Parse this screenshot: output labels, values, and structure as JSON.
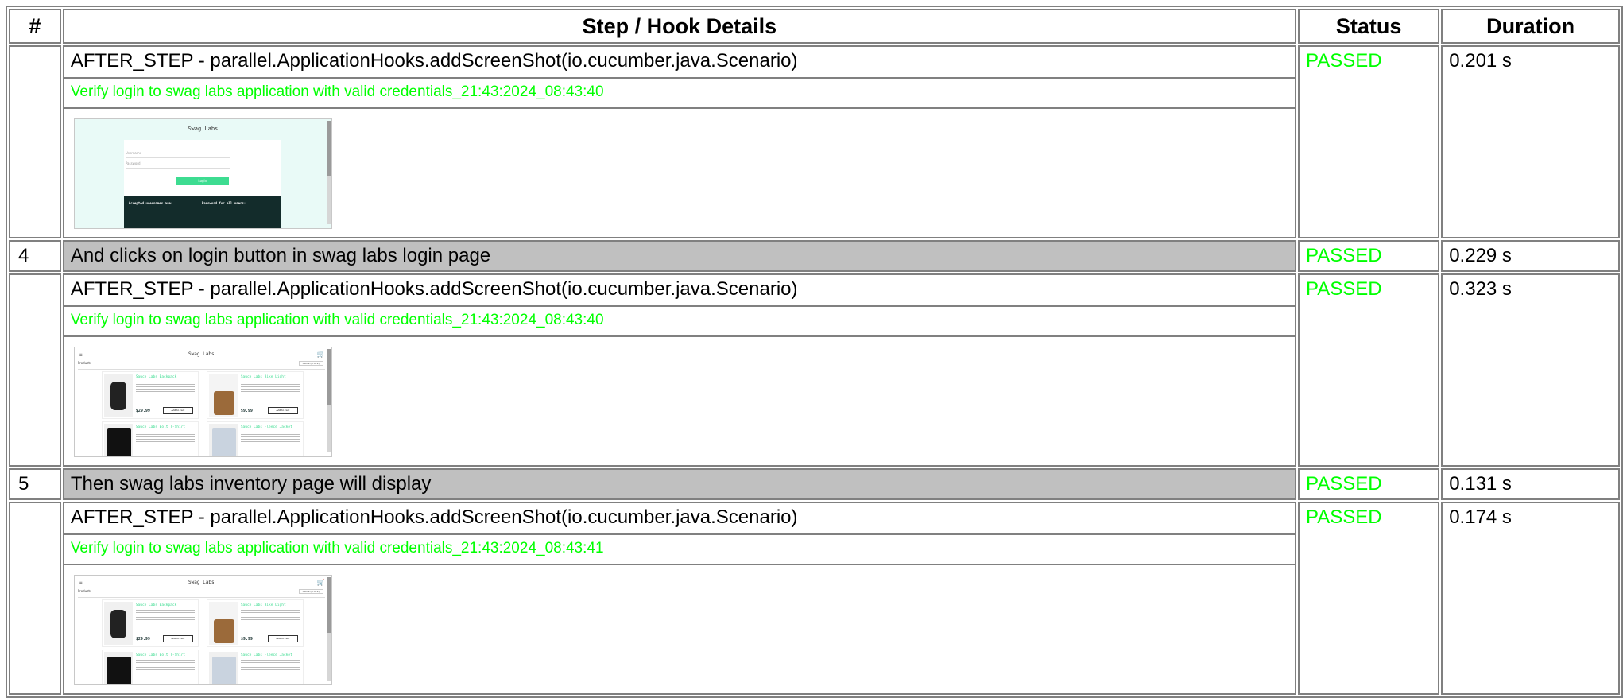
{
  "header": {
    "num": "#",
    "step": "Step / Hook Details",
    "status": "Status",
    "duration": "Duration"
  },
  "hooks": [
    {
      "title": "AFTER_STEP - parallel.ApplicationHooks.addScreenShot(io.cucumber.java.Scenario)",
      "name": "Verify login to swag labs application with valid credentials_21:43:2024_08:43:40",
      "status": "PASSED",
      "duration": "0.201 s",
      "screenshot": {
        "type": "login",
        "title": "Swag Labs",
        "username_placeholder": "Username",
        "password_placeholder": "Password",
        "button": "Login",
        "accepted_heading": "Accepted usernames are:",
        "password_heading": "Password for all users:"
      }
    },
    {
      "title": "AFTER_STEP - parallel.ApplicationHooks.addScreenShot(io.cucumber.java.Scenario)",
      "name": "Verify login to swag labs application with valid credentials_21:43:2024_08:43:40",
      "status": "PASSED",
      "duration": "0.323 s",
      "screenshot": {
        "type": "inventory",
        "title": "Swag Labs",
        "menu": "≡",
        "cart": "🛒",
        "section": "Products",
        "sort": "Name (A to Z)",
        "products": [
          {
            "name": "Sauce Labs Backpack",
            "price": "$29.99",
            "button": "Add to cart"
          },
          {
            "name": "Sauce Labs Bike Light",
            "price": "$9.99",
            "button": "Add to cart"
          },
          {
            "name": "Sauce Labs Bolt T-Shirt",
            "price": "",
            "button": ""
          },
          {
            "name": "Sauce Labs Fleece Jacket",
            "price": "",
            "button": ""
          }
        ]
      }
    },
    {
      "title": "AFTER_STEP - parallel.ApplicationHooks.addScreenShot(io.cucumber.java.Scenario)",
      "name": "Verify login to swag labs application with valid credentials_21:43:2024_08:43:41",
      "status": "PASSED",
      "duration": "0.174 s",
      "screenshot": {
        "type": "inventory",
        "title": "Swag Labs",
        "menu": "≡",
        "cart": "🛒",
        "section": "Products",
        "sort": "Name (A to Z)",
        "products": [
          {
            "name": "Sauce Labs Backpack",
            "price": "$29.99",
            "button": "Add to cart"
          },
          {
            "name": "Sauce Labs Bike Light",
            "price": "$9.99",
            "button": "Add to cart"
          },
          {
            "name": "Sauce Labs Bolt T-Shirt",
            "price": "",
            "button": ""
          },
          {
            "name": "Sauce Labs Fleece Jacket",
            "price": "",
            "button": ""
          }
        ]
      }
    }
  ],
  "steps": [
    {
      "num": "4",
      "text": "And clicks on login button in swag labs login page",
      "status": "PASSED",
      "duration": "0.229 s"
    },
    {
      "num": "5",
      "text": "Then swag labs inventory page will display",
      "status": "PASSED",
      "duration": "0.131 s"
    }
  ],
  "colors": {
    "passed": "#00ff00",
    "step_bg": "#c0c0c0",
    "border": "#808080"
  }
}
